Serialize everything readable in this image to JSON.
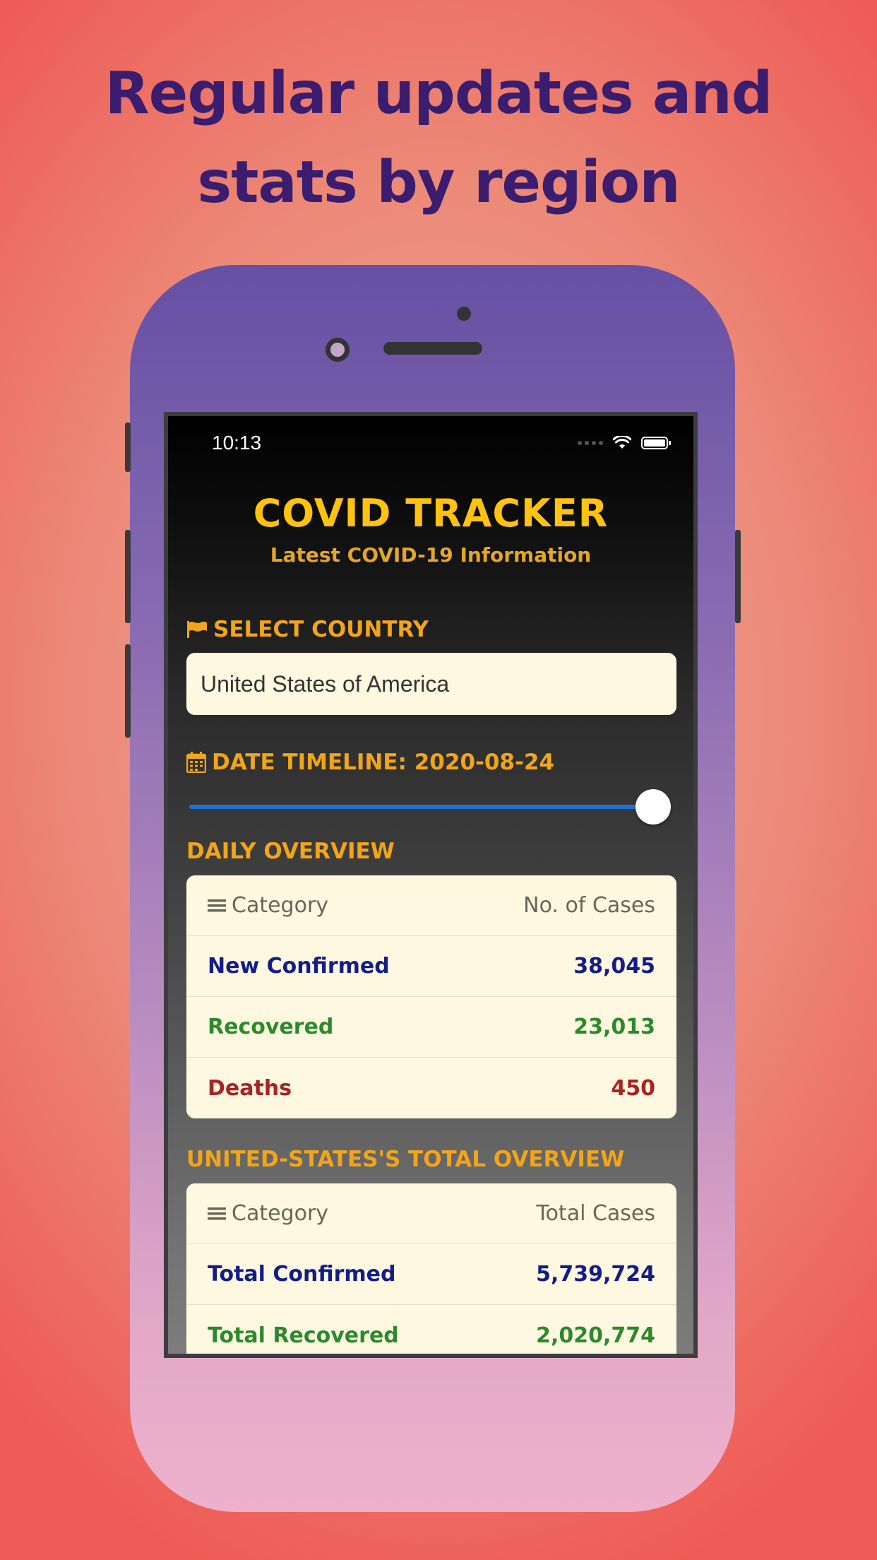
{
  "headline": {
    "line1": "Regular updates and",
    "line2": "stats by region"
  },
  "status_bar": {
    "time": "10:13"
  },
  "app": {
    "title": "COVID TRACKER",
    "subtitle": "Latest COVID-19 Information"
  },
  "country": {
    "label": "SELECT COUNTRY",
    "value": "United States of America"
  },
  "timeline": {
    "label": "DATE TIMELINE: 2020-08-24",
    "slider_fraction": 1.0
  },
  "daily": {
    "title": "DAILY OVERVIEW",
    "header_category": "Category",
    "header_value": "No. of Cases",
    "rows": [
      {
        "label": "New Confirmed",
        "value": "38,045",
        "color": "#121d8a"
      },
      {
        "label": "Recovered",
        "value": "23,013",
        "color": "#2b8a2b"
      },
      {
        "label": "Deaths",
        "value": "450",
        "color": "#aa2222"
      }
    ]
  },
  "total": {
    "title": "UNITED-STATES'S TOTAL OVERVIEW",
    "header_category": "Category",
    "header_value": "Total Cases",
    "rows": [
      {
        "label": "Total Confirmed",
        "value": "5,739,724",
        "color": "#121d8a"
      },
      {
        "label": "Total Recovered",
        "value": "2,020,774",
        "color": "#2b8a2b"
      }
    ]
  },
  "colors": {
    "accent": "#f2a51a",
    "title_yellow": "#ffc30f",
    "slider_blue": "#1e72d6",
    "headline_purple": "#3a1d6e"
  }
}
